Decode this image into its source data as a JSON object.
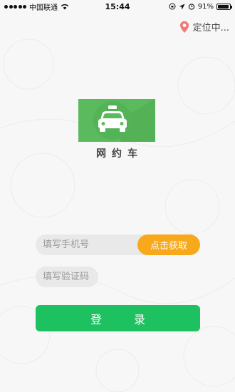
{
  "status_bar": {
    "carrier": "中国联通",
    "time": "15:44",
    "battery_text": "91%",
    "battery_level": 0.91
  },
  "location": {
    "label": "定位中..."
  },
  "app": {
    "name": "网约车",
    "logo_color": "#5cba5e"
  },
  "form": {
    "phone_placeholder": "填写手机号",
    "get_code_label": "点击获取",
    "code_placeholder": "填写验证码",
    "login_label": "登录"
  },
  "colors": {
    "accent_orange": "#f7a91b",
    "primary_green": "#1ec15f",
    "location_pin": "#f07b74"
  },
  "icons": [
    "signal-icon",
    "wifi-icon",
    "orientation-lock-icon",
    "location-arrow-icon",
    "alarm-icon",
    "battery-icon",
    "location-pin-icon",
    "taxi-icon"
  ]
}
